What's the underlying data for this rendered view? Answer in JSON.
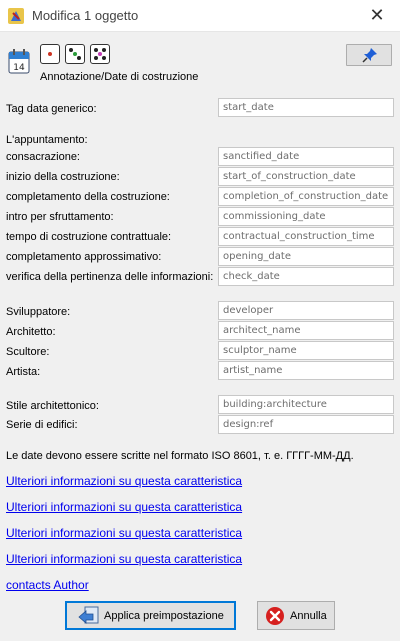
{
  "window": {
    "title": "Modifica 1 oggetto",
    "close_glyph": "✕"
  },
  "header": {
    "preset_title": "Annotazione/Date di costruzione",
    "calendar_icon_text": "14"
  },
  "fields": [
    {
      "label": "Tag data generico:",
      "placeholder": "start_date"
    },
    {
      "label": "consacrazione:",
      "placeholder": "sanctified_date"
    },
    {
      "label": "inizio della costruzione:",
      "placeholder": "start_of_construction_date"
    },
    {
      "label": "completamento della costruzione:",
      "placeholder": "completion_of_construction_date"
    },
    {
      "label": "intro per sfruttamento:",
      "placeholder": "commissioning_date"
    },
    {
      "label": "tempo di costruzione contrattuale:",
      "placeholder": "contractual_construction_time"
    },
    {
      "label": "completamento approssimativo:",
      "placeholder": "opening_date"
    },
    {
      "label": "verifica della pertinenza delle informazioni:",
      "placeholder": "check_date"
    },
    {
      "label": "Sviluppatore:",
      "placeholder": "developer"
    },
    {
      "label": "Architetto:",
      "placeholder": "architect_name"
    },
    {
      "label": "Scultore:",
      "placeholder": "sculptor_name"
    },
    {
      "label": "Artista:",
      "placeholder": "artist_name"
    },
    {
      "label": "Stile architettonico:",
      "placeholder": "building:architecture"
    },
    {
      "label": "Serie di edifici:",
      "placeholder": "design:ref"
    }
  ],
  "section_label": "L'appuntamento:",
  "note": "Le date devono essere scritte nel formato ISO 8601, т. е. ГГГГ-ММ-ДД.",
  "links": [
    "Ulteriori informazioni su questa caratteristica",
    "Ulteriori informazioni su questa caratteristica",
    "Ulteriori informazioni su questa caratteristica",
    "Ulteriori informazioni su questa caratteristica",
    "contacts Author"
  ],
  "buttons": {
    "apply": "Applica preimpostazione",
    "cancel": "Annulla"
  },
  "colors": {
    "link": "#0000ee",
    "cancel_red": "#d6201f",
    "pin_blue": "#1f5fd6",
    "focus_blue": "#0078d7"
  }
}
